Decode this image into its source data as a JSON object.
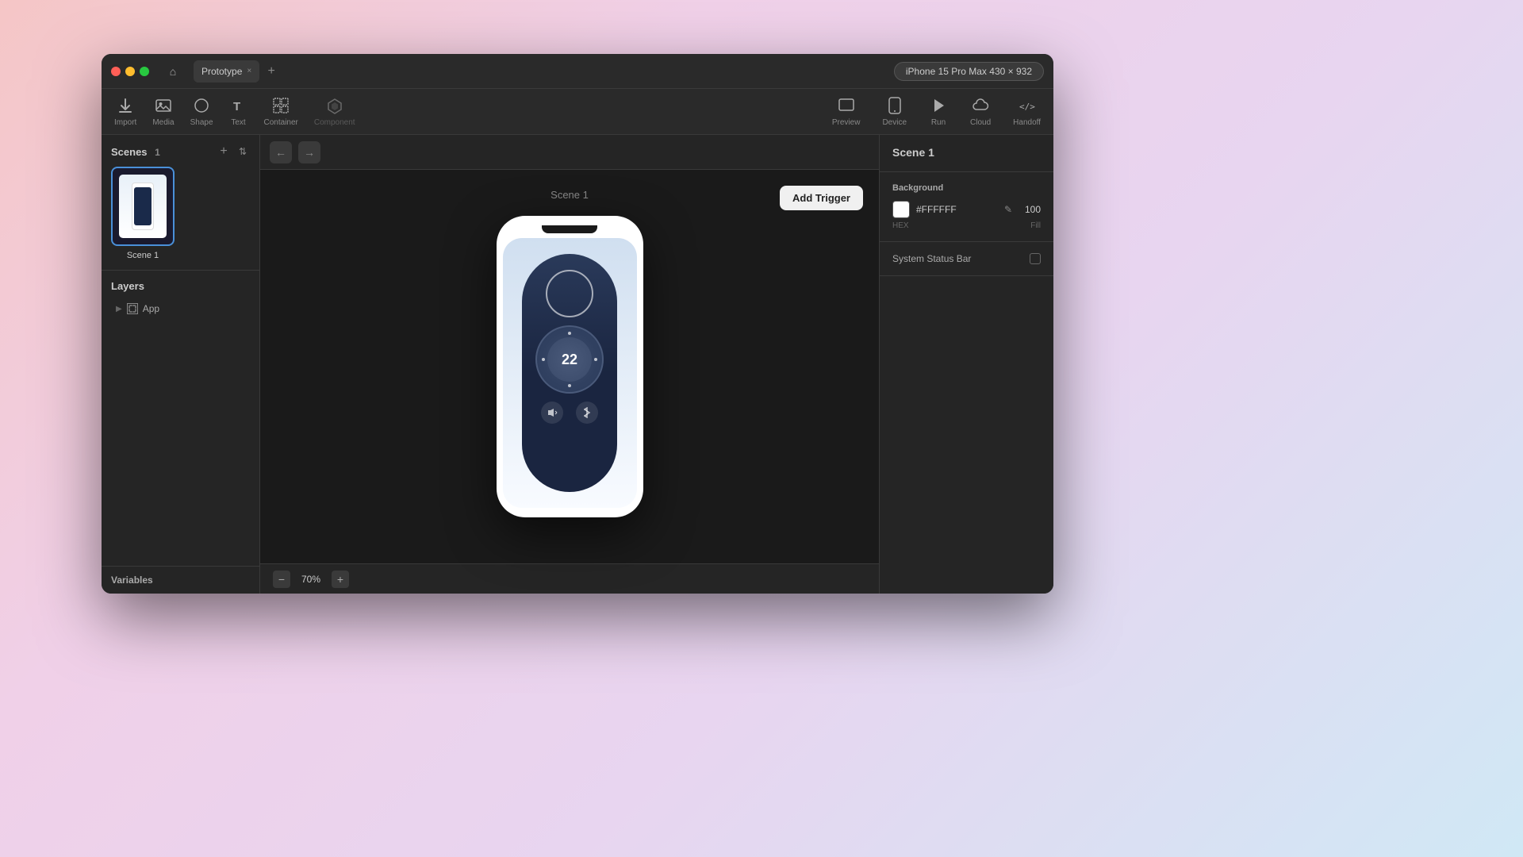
{
  "window": {
    "title": "Prototype",
    "tab_close": "×",
    "tab_add": "+",
    "device_selector": "iPhone 15 Pro Max 430 × 932"
  },
  "toolbar": {
    "import_label": "Import",
    "media_label": "Media",
    "shape_label": "Shape",
    "text_label": "Text",
    "container_label": "Container",
    "component_label": "Component",
    "preview_label": "Preview",
    "device_label": "Device",
    "run_label": "Run",
    "cloud_label": "Cloud",
    "handoff_label": "Handoff"
  },
  "sidebar": {
    "scenes_label": "Scenes",
    "scenes_count": "1",
    "scene1_label": "Scene 1",
    "layers_label": "Layers",
    "layer_item": "App",
    "variables_label": "Variables"
  },
  "canvas": {
    "scene_label": "Scene 1",
    "add_trigger_btn": "Add Trigger",
    "nav_back": "←",
    "nav_forward": "→"
  },
  "phone": {
    "dial_value": "22"
  },
  "zoom": {
    "minus": "−",
    "value": "70%",
    "plus": "+"
  },
  "right_panel": {
    "scene_name": "Scene 1",
    "background_label": "Background",
    "hex_value": "#FFFFFF",
    "hex_label": "HEX",
    "fill_label": "Fill",
    "opacity_value": "100",
    "system_status_bar_label": "System Status Bar"
  },
  "icons": {
    "home": "⌂",
    "import": "↓",
    "media": "🖼",
    "shape": "○",
    "text": "T",
    "container": "⊞",
    "component": "⚡",
    "preview": "□",
    "device": "📱",
    "run": "▶",
    "cloud": "☁",
    "handoff": "</>",
    "layer_expand": "▶",
    "scene_add": "+",
    "scene_sort": "⇅",
    "pencil": "✎"
  }
}
